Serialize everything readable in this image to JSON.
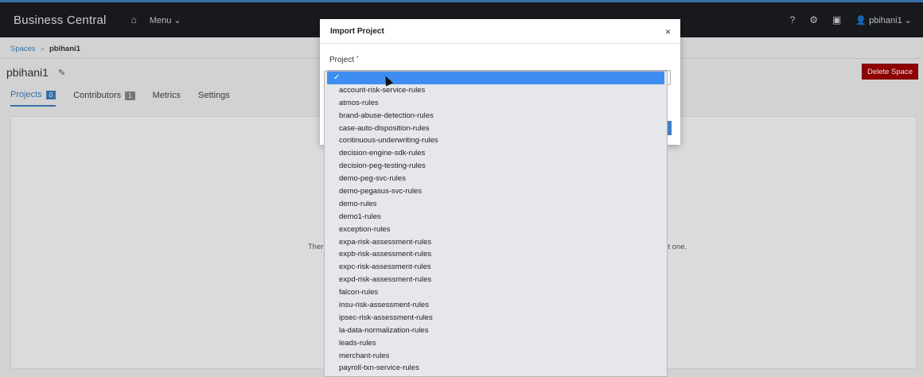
{
  "topnav": {
    "brand": "Business Central",
    "home_icon": "home-icon",
    "menu_label": "Menu ⌄",
    "help": "?",
    "settings_icon": "gear-icon",
    "camera_icon": "camera-icon",
    "user": "pbihani1 ⌄"
  },
  "breadcrumb": {
    "spaces": "Spaces",
    "separator": "»",
    "current": "pbihani1"
  },
  "space": {
    "title": "pbihani1",
    "delete_label": "Delete Space"
  },
  "tabs": [
    {
      "label": "Projects",
      "count": "0"
    },
    {
      "label": "Contributors",
      "count": "1"
    },
    {
      "label": "Metrics"
    },
    {
      "label": "Settings"
    }
  ],
  "empty_state": {
    "left_fragment": "Ther",
    "right_fragment": "ort one."
  },
  "modal": {
    "title": "Import Project",
    "close": "×",
    "project_label": "Project",
    "required_mark": "*"
  },
  "dropdown": {
    "selected_mark": "✓",
    "options": [
      "account-risk-service-rules",
      "atmos-rules",
      "brand-abuse-detection-rules",
      "case-auto-disposition-rules",
      "continuous-underwriting-rules",
      "decision-engine-sdk-rules",
      "decision-peg-testing-rules",
      "demo-peg-svc-rules",
      "demo-pegasus-svc-rules",
      "demo-rules",
      "demo1-rules",
      "exception-rules",
      "expa-risk-assessment-rules",
      "expb-risk-assessment-rules",
      "expc-risk-assessment-rules",
      "expd-risk-assessment-rules",
      "falcon-rules",
      "insu-risk-assessment-rules",
      "ipsec-risk-assessment-rules",
      "la-data-normalization-rules",
      "leads-rules",
      "merchant-rules",
      "payroll-txn-service-rules"
    ]
  },
  "colors": {
    "accent": "#3f7fc0",
    "danger": "#a30000",
    "nav_bg": "#1b1d21",
    "selection": "#3d8ef0"
  }
}
